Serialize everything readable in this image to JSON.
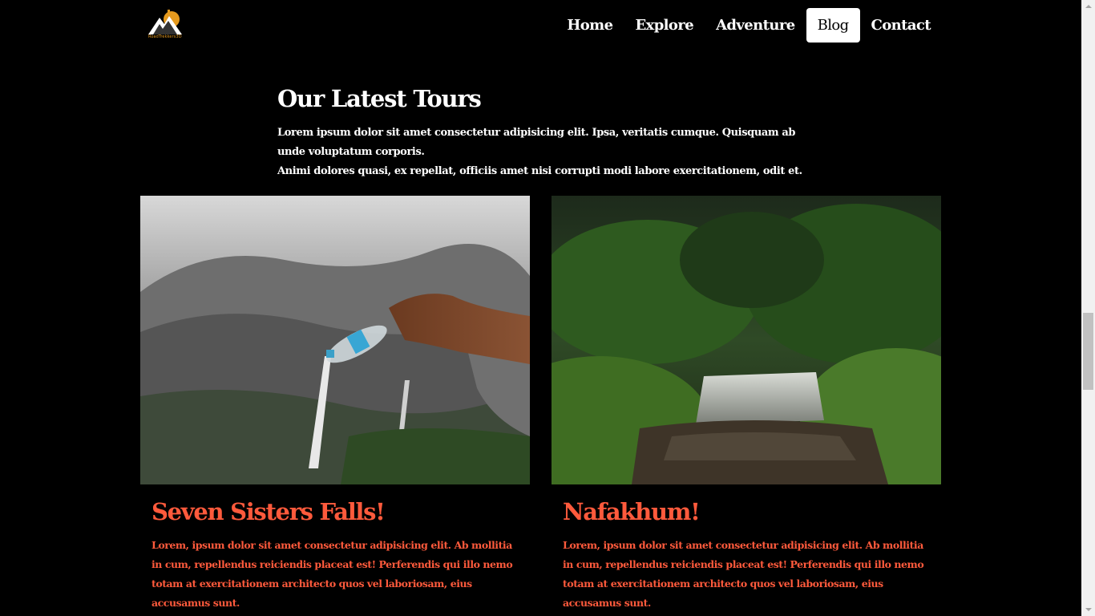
{
  "brand": {
    "logo_text": "RoadTrekkers3D"
  },
  "nav": {
    "items": [
      {
        "label": "Home",
        "active": false
      },
      {
        "label": "Explore",
        "active": false
      },
      {
        "label": "Adventure",
        "active": false
      },
      {
        "label": "Blog",
        "active": true
      },
      {
        "label": "Contact",
        "active": false
      }
    ]
  },
  "intro": {
    "title": "Our Latest Tours",
    "text_line1": "Lorem ipsum dolor sit amet consectetur adipisicing elit. Ipsa, veritatis cumque. Quisquam ab unde voluptatum corporis.",
    "text_line2": "Animi dolores quasi, ex repellat, officiis amet nisi corrupti modi labore exercitationem, odit et."
  },
  "cards": [
    {
      "title": "Seven Sisters Falls!",
      "text": "Lorem, ipsum dolor sit amet consectetur adipisicing elit. Ab mollitia in cum, repellendus reiciendis placeat est! Perferendis qui illo nemo totam at exercitationem architecto quos vel laboriosam, eius accusamus sunt.",
      "image": "waterfall-with-hand-pouring-water-bottle"
    },
    {
      "title": "Nafakhum!",
      "text": "Lorem, ipsum dolor sit amet consectetur adipisicing elit. Ab mollitia in cum, repellendus reiciendis placeat est! Perferendis qui illo nemo totam at exercitationem architecto quos vel laboriosam, eius accusamus sunt.",
      "image": "jungle-waterfall-river"
    }
  ],
  "colors": {
    "accent": "#ff5a3c",
    "background": "#000000",
    "text": "#ffffff"
  }
}
